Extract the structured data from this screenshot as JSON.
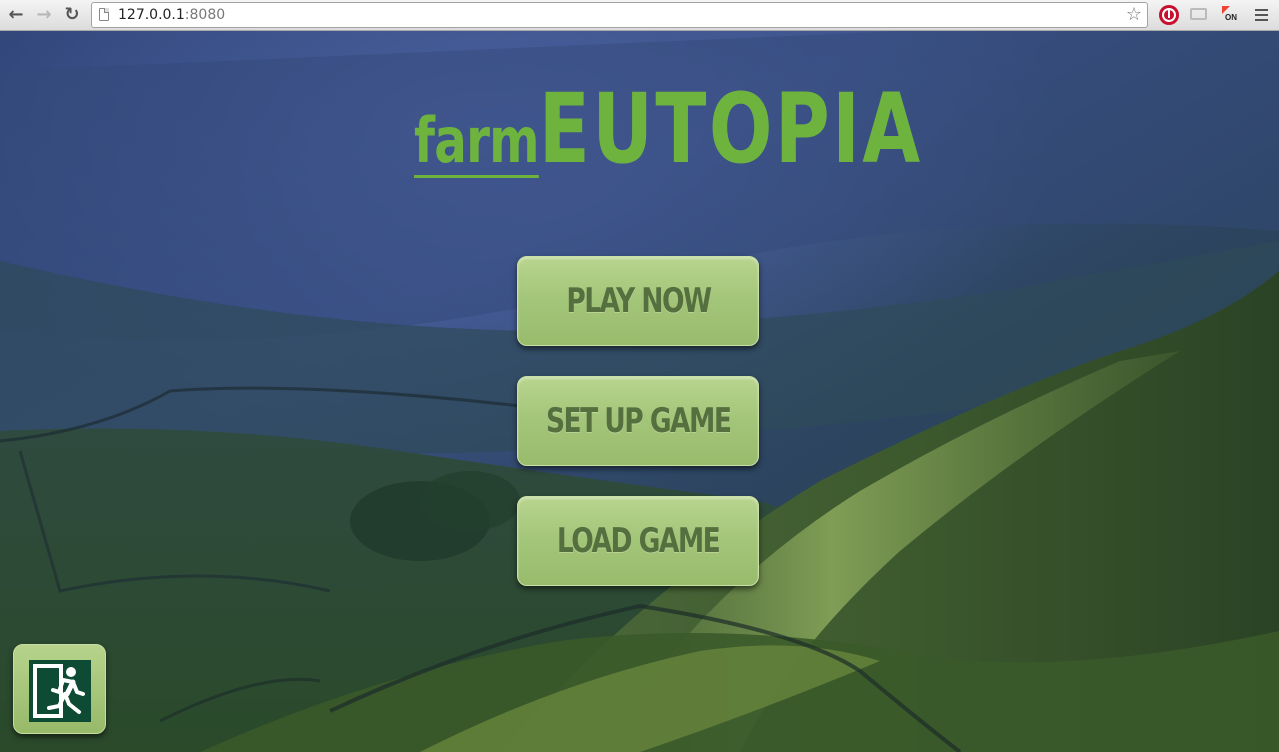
{
  "browser": {
    "url_host": "127.0.0.1",
    "url_port": ":8080",
    "icons": [
      "back-arrow-icon",
      "forward-arrow-icon",
      "reload-icon",
      "page-icon",
      "bookmark-star-icon",
      "stop-extension-icon",
      "cast-icon",
      "on-extension-icon",
      "chrome-menu-icon"
    ]
  },
  "logo": {
    "farm": "farm",
    "eutopia": "EUTOPIA",
    "color": "#6fb33f"
  },
  "menu": {
    "play": "PLAY NOW",
    "setup": "SET UP GAME",
    "load": "LOAD GAME"
  },
  "exit": {
    "icon": "emergency-exit-icon"
  },
  "colors": {
    "button_fill": "#a4c67a",
    "button_text": "#566f3f",
    "exit_sign": "#0e4b35"
  }
}
